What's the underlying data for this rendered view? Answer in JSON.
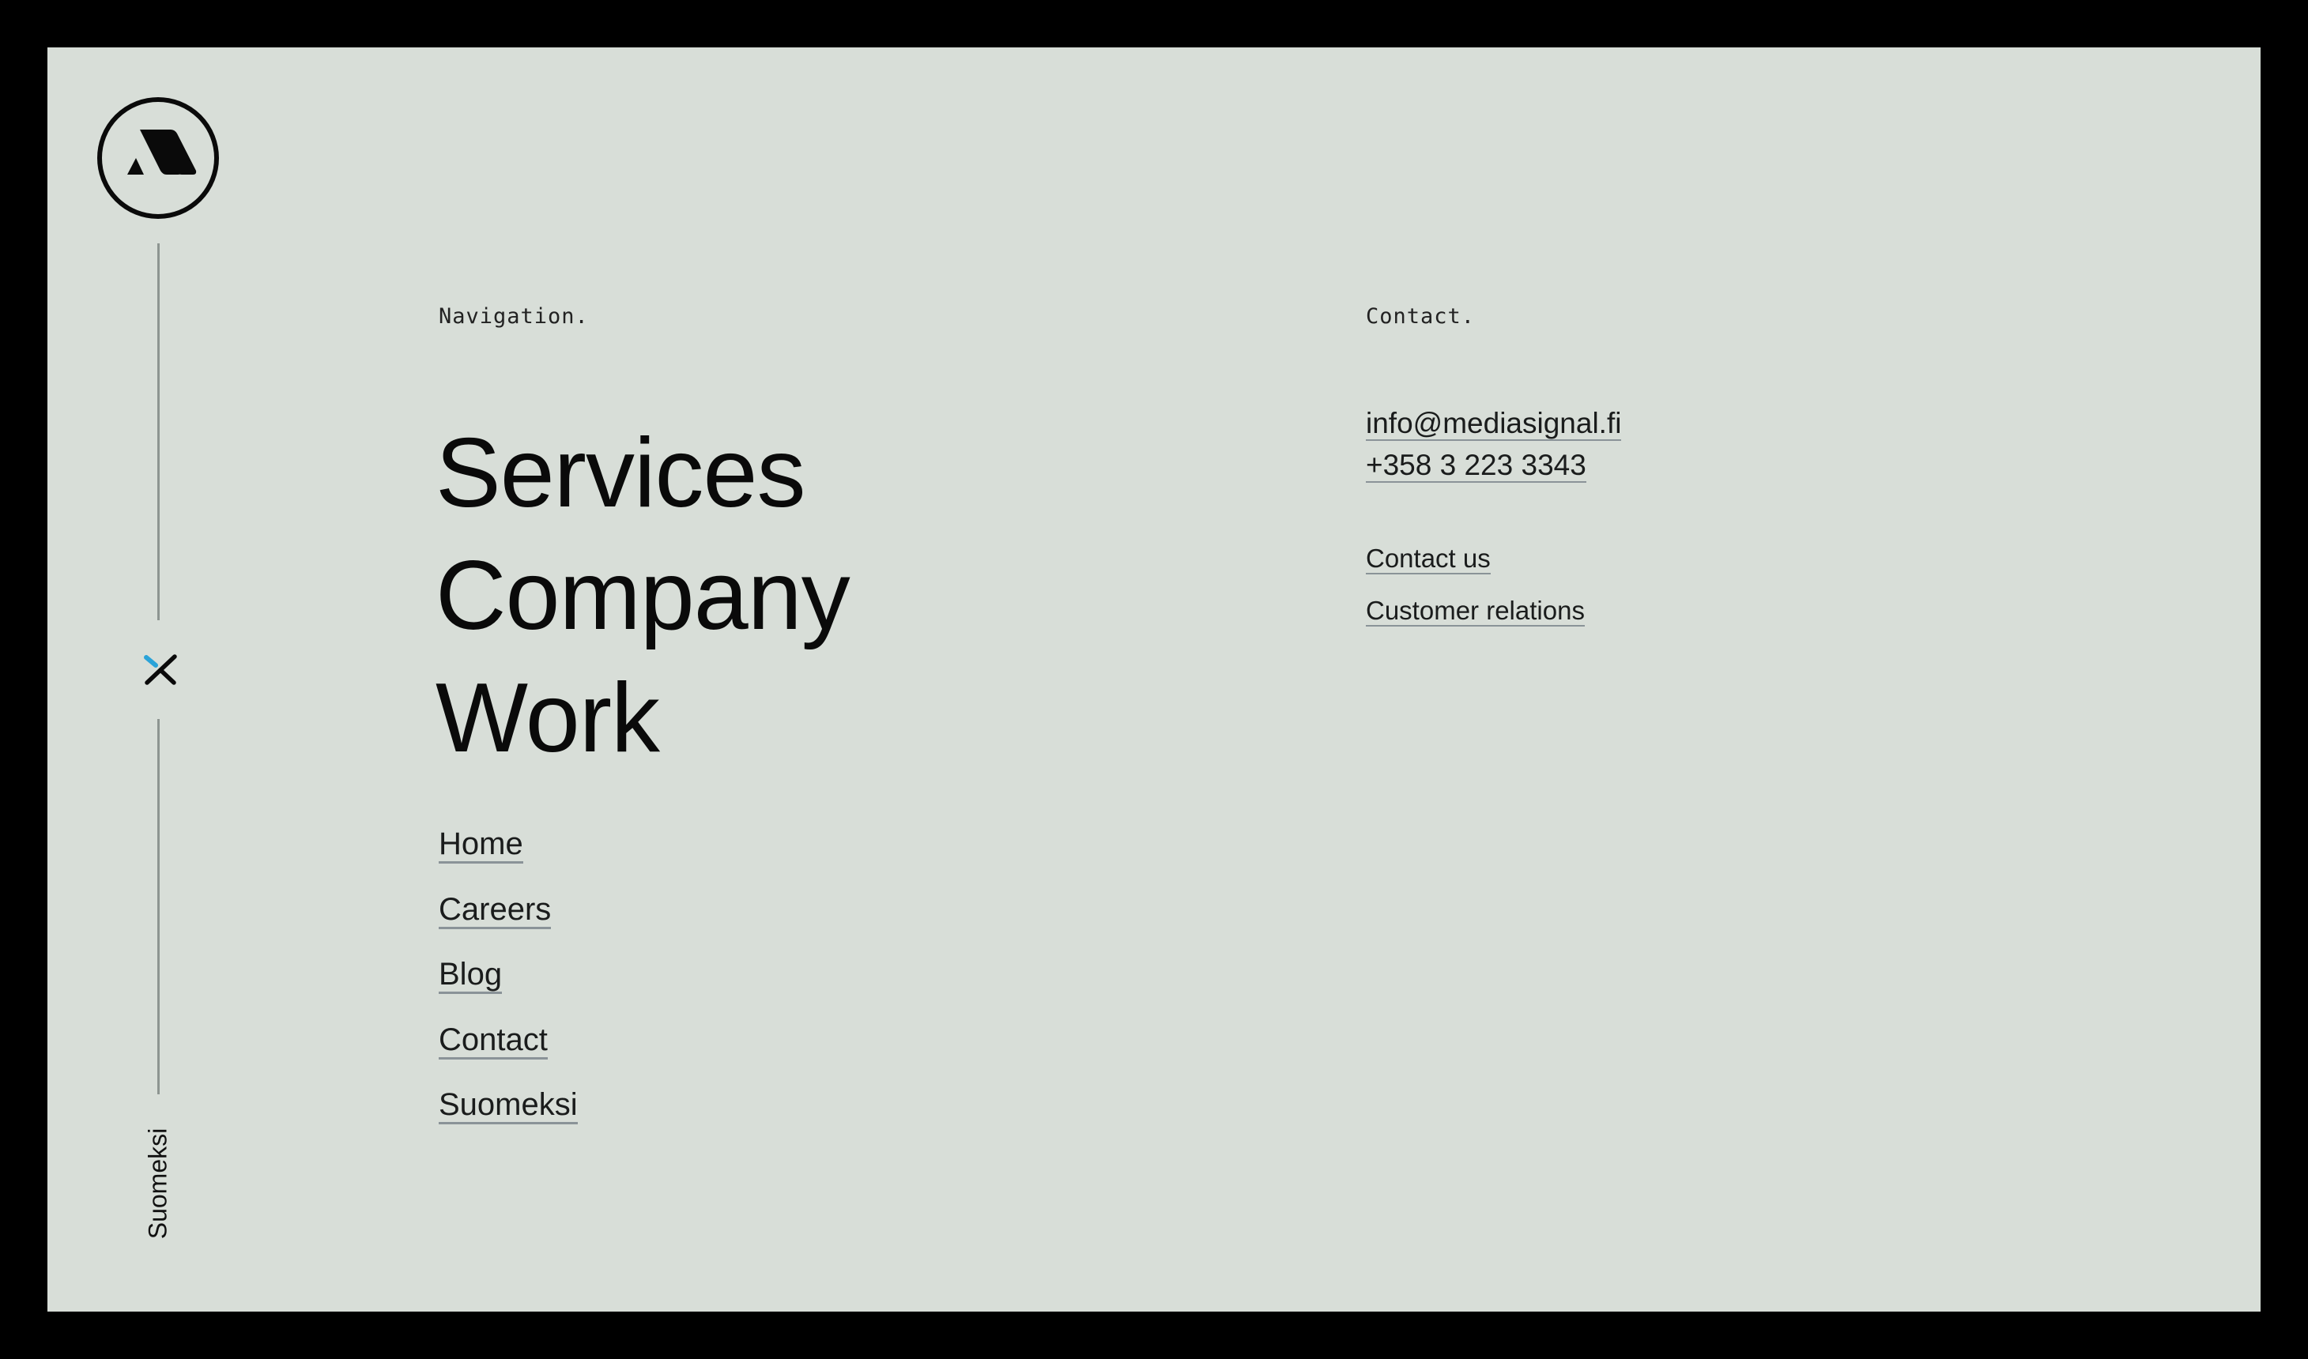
{
  "brand": {
    "logo_icon": "mediasignal-logo-icon",
    "accent_color": "#2aa3d8",
    "background_color": "#d8ded8",
    "frame_color": "#000000"
  },
  "sidebar": {
    "close_icon": "close-x-icon",
    "language_label": "Suomeksi"
  },
  "navigation": {
    "heading": "Navigation.",
    "primary_links": [
      {
        "label": "Services"
      },
      {
        "label": "Company"
      },
      {
        "label": "Work"
      }
    ],
    "secondary_links": [
      {
        "label": "Home"
      },
      {
        "label": "Careers"
      },
      {
        "label": "Blog"
      },
      {
        "label": "Contact"
      },
      {
        "label": "Suomeksi"
      }
    ]
  },
  "contact": {
    "heading": "Contact.",
    "email": "info@mediasignal.fi",
    "phone": "+358 3 223 3343",
    "links": [
      {
        "label": "Contact us"
      },
      {
        "label": "Customer relations"
      }
    ]
  }
}
